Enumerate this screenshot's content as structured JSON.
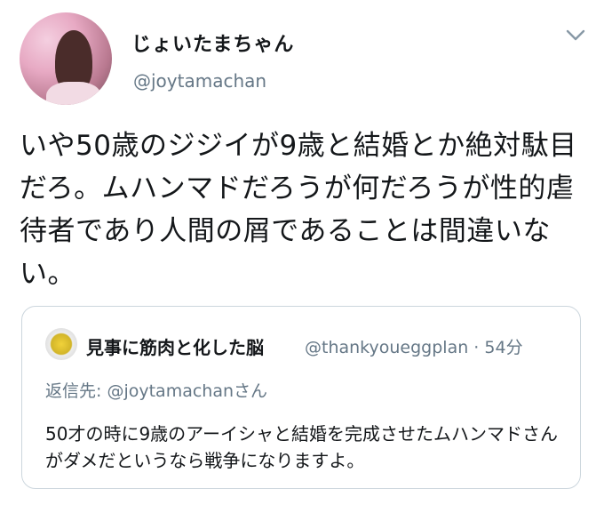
{
  "tweet": {
    "display_name": "じょいたまちゃん",
    "handle": "@joytamachan",
    "text": "いや50歳のジジイが9歳と結婚とか絶対駄目だろ。ムハンマドだろうが何だろうが性的虐待者であり人間の屑であることは間違いない。",
    "menu_icon": "chevron-down-icon"
  },
  "quoted": {
    "display_name": "見事に筋肉と化した脳",
    "handle": "@thankyoueggplan",
    "separator": "·",
    "time": "54分",
    "reply_prefix": "返信先: ",
    "reply_handle": "@joytamachan",
    "reply_suffix": "さん",
    "text": "50才の時に9歳のアーイシャと結婚を完成させたムハンマドさんがダメだというなら戦争になりますよ。"
  }
}
